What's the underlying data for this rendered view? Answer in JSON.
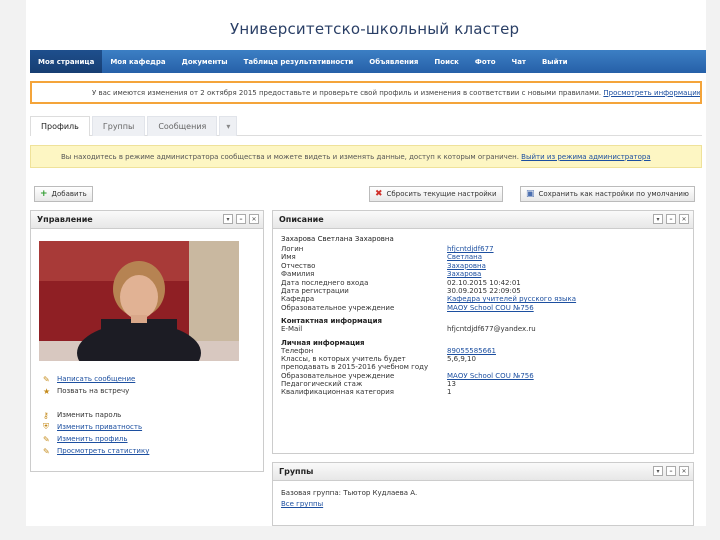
{
  "header": {
    "title": "Университетско-школьный кластер"
  },
  "nav": {
    "items": [
      {
        "label": "Моя страница"
      },
      {
        "label": "Моя кафедра"
      },
      {
        "label": "Документы"
      },
      {
        "label": "Таблица результативности"
      },
      {
        "label": "Объявления"
      },
      {
        "label": "Поиск"
      },
      {
        "label": "Фото"
      },
      {
        "label": "Чат"
      },
      {
        "label": "Выйти"
      }
    ]
  },
  "notice": {
    "text": "У вас имеются изменения от 2 октября 2015 предоставьте и проверьте свой профиль и изменения в соответствии с новыми правилами.",
    "link": "Просмотреть информацию"
  },
  "tabs": [
    {
      "label": "Профиль"
    },
    {
      "label": "Группы"
    },
    {
      "label": "Сообщения"
    },
    {
      "label": "▾"
    }
  ],
  "admin_notice": {
    "text": "Вы находитесь в режиме администратора сообщества и можете видеть и изменять данные, доступ к которым ограничен.",
    "link": "Выйти из режима администратора"
  },
  "toolbar": {
    "add": "Добавить",
    "reset": "Сбросить текущие настройки",
    "save_default": "Сохранить как настройки по умолчанию"
  },
  "management": {
    "title": "Управление",
    "actions": [
      {
        "label": "Написать сообщение",
        "icon": "pencil-icon"
      },
      {
        "label": "Позвать на встречу",
        "icon": "star-icon"
      },
      {
        "label": "Изменить пароль",
        "icon": "key-icon"
      },
      {
        "label": "Изменить приватность",
        "icon": "shield-icon"
      },
      {
        "label": "Изменить профиль",
        "icon": "pencil-icon"
      },
      {
        "label": "Просмотреть статистику",
        "icon": "pencil-icon"
      }
    ]
  },
  "description": {
    "title": "Описание",
    "full_name": "Захарова Светлана Захаровна",
    "rows": [
      {
        "k": "Логин",
        "v": "hfjcntdjdf677",
        "link": true
      },
      {
        "k": "Имя",
        "v": "Светлана",
        "link": true
      },
      {
        "k": "Отчество",
        "v": "Захаровна",
        "link": true
      },
      {
        "k": "Фамилия",
        "v": "Захарова",
        "link": true
      },
      {
        "k": "Дата последнего входа",
        "v": "02.10.2015 10:42:01",
        "link": false
      },
      {
        "k": "Дата регистрации",
        "v": "30.09.2015 22:09:05",
        "link": false
      },
      {
        "k": "Кафедра",
        "v": "Кафедра учителей русского языка",
        "link": true
      },
      {
        "k": "Образовательное учреждение",
        "v": "МАОУ School COU №756",
        "link": true
      }
    ],
    "contact_header": "Контактная информация",
    "contact_rows": [
      {
        "k": "E-Mail",
        "v": "hfjcntdjdf677@yandex.ru",
        "link": false
      }
    ],
    "personal_header": "Личная информация",
    "personal_rows": [
      {
        "k": "Телефон",
        "v": "89055585661",
        "link": true
      },
      {
        "k": "Классы, в которых учитель будет",
        "v": "5,6,9,10",
        "link": false
      },
      {
        "k": "преподавать в 2015-2016 учебном году",
        "v": "",
        "link": false
      },
      {
        "k": "Образовательное учреждение",
        "v": "МАОУ School COU №756",
        "link": true
      },
      {
        "k": "Педагогический стаж",
        "v": "13",
        "link": false
      },
      {
        "k": "Квалификационная категория",
        "v": "1",
        "link": false
      }
    ]
  },
  "groups": {
    "title": "Группы",
    "line": "Базовая группа: Тьютор Кудлаева А.",
    "all_link": "Все группы"
  },
  "colors": {
    "nav_bg": "#2660a8",
    "nav_active": "#173e72",
    "notice_border": "#f4a43a",
    "admin_bg": "#fdf6c3",
    "link": "#1c4fa0"
  }
}
